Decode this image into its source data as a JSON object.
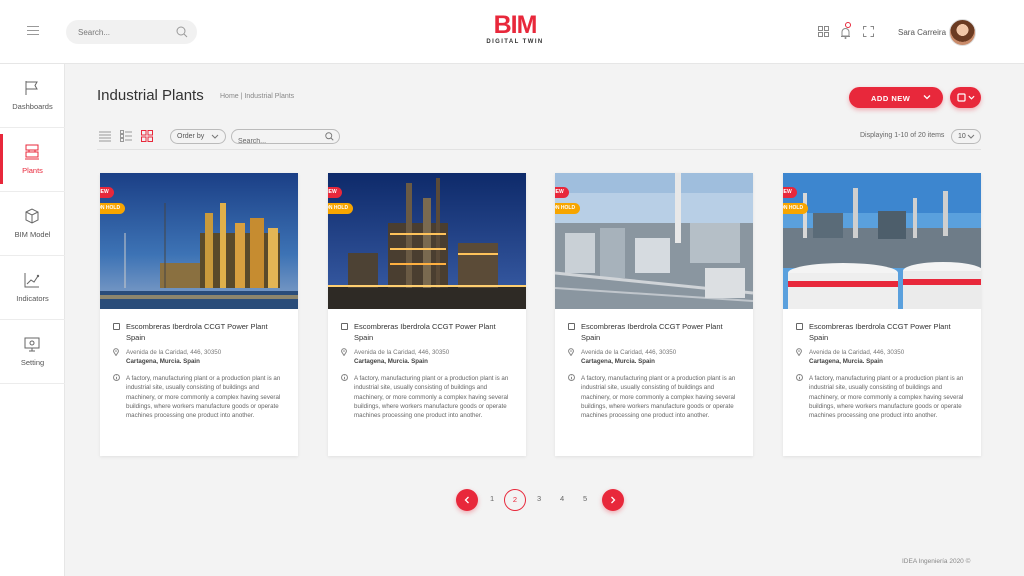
{
  "header": {
    "search_placeholder": "Search...",
    "logo_mark": "BIM",
    "logo_sub": "DIGITAL TWIN",
    "user_name": "Sara Carreira",
    "icons": [
      "menu-icon",
      "search-icon",
      "grid-icon",
      "bell-icon",
      "fullscreen-icon"
    ]
  },
  "sidebar": {
    "items": [
      {
        "label": "Dashboards",
        "icon": "flag-icon",
        "active": false
      },
      {
        "label": "Plants",
        "icon": "plants-icon",
        "active": true
      },
      {
        "label": "BIM Model",
        "icon": "cube-icon",
        "active": false
      },
      {
        "label": "Indicators",
        "icon": "chart-icon",
        "active": false
      },
      {
        "label": "Setting",
        "icon": "settings-icon",
        "active": false
      }
    ]
  },
  "page": {
    "title": "Industrial Plants",
    "breadcrumb": "Home | Industrial Plants",
    "add_new_label": "ADD NEW"
  },
  "toolbar": {
    "order_by_label": "Order by",
    "search_placeholder": "Search...",
    "displaying": "Displaying 1-10 of 20 items",
    "per_page": "10"
  },
  "cards": [
    {
      "badge_new": "NEW",
      "badge_status": "ON HOLD",
      "title": "Escombreras Iberdrola CCGT Power Plant Spain",
      "address": "Avenida de la Caridad, 446, 30350",
      "city": "Cartagena, Murcia. Spain",
      "description": "A factory, manufacturing plant or a production plant is an industrial site, usually consisting of buildings and machinery, or more commonly a complex having several buildings, where workers manufacture goods or operate machines processing one product into another."
    },
    {
      "badge_new": "NEW",
      "badge_status": "ON HOLD",
      "title": "Escombreras Iberdrola CCGT Power Plant Spain",
      "address": "Avenida de la Caridad, 446, 30350",
      "city": "Cartagena, Murcia. Spain",
      "description": "A factory, manufacturing plant or a production plant is an industrial site, usually consisting of buildings and machinery, or more commonly a complex having several buildings, where workers manufacture goods or operate machines processing one product into another."
    },
    {
      "badge_new": "NEW",
      "badge_status": "ON HOLD",
      "title": "Escombreras Iberdrola CCGT Power Plant Spain",
      "address": "Avenida de la Caridad, 446, 30350",
      "city": "Cartagena, Murcia. Spain",
      "description": "A factory, manufacturing plant or a production plant is an industrial site, usually consisting of buildings and machinery, or more commonly a complex having several buildings, where workers manufacture goods or operate machines processing one product into another."
    },
    {
      "badge_new": "NEW",
      "badge_status": "ON HOLD",
      "title": "Escombreras Iberdrola CCGT Power Plant Spain",
      "address": "Avenida de la Caridad, 446, 30350",
      "city": "Cartagena, Murcia. Spain",
      "description": "A factory, manufacturing plant or a production plant is an industrial site, usually consisting of buildings and machinery, or more commonly a complex having several buildings, where workers manufacture goods or operate machines processing one product into another."
    }
  ],
  "pagination": {
    "pages": [
      "1",
      "2",
      "3",
      "4",
      "5"
    ],
    "current": "2"
  },
  "footer": "IDEA Ingeniería 2020 ©",
  "colors": {
    "accent": "#e8283b",
    "on_hold": "#f7a500",
    "background": "#f3f3f3"
  }
}
